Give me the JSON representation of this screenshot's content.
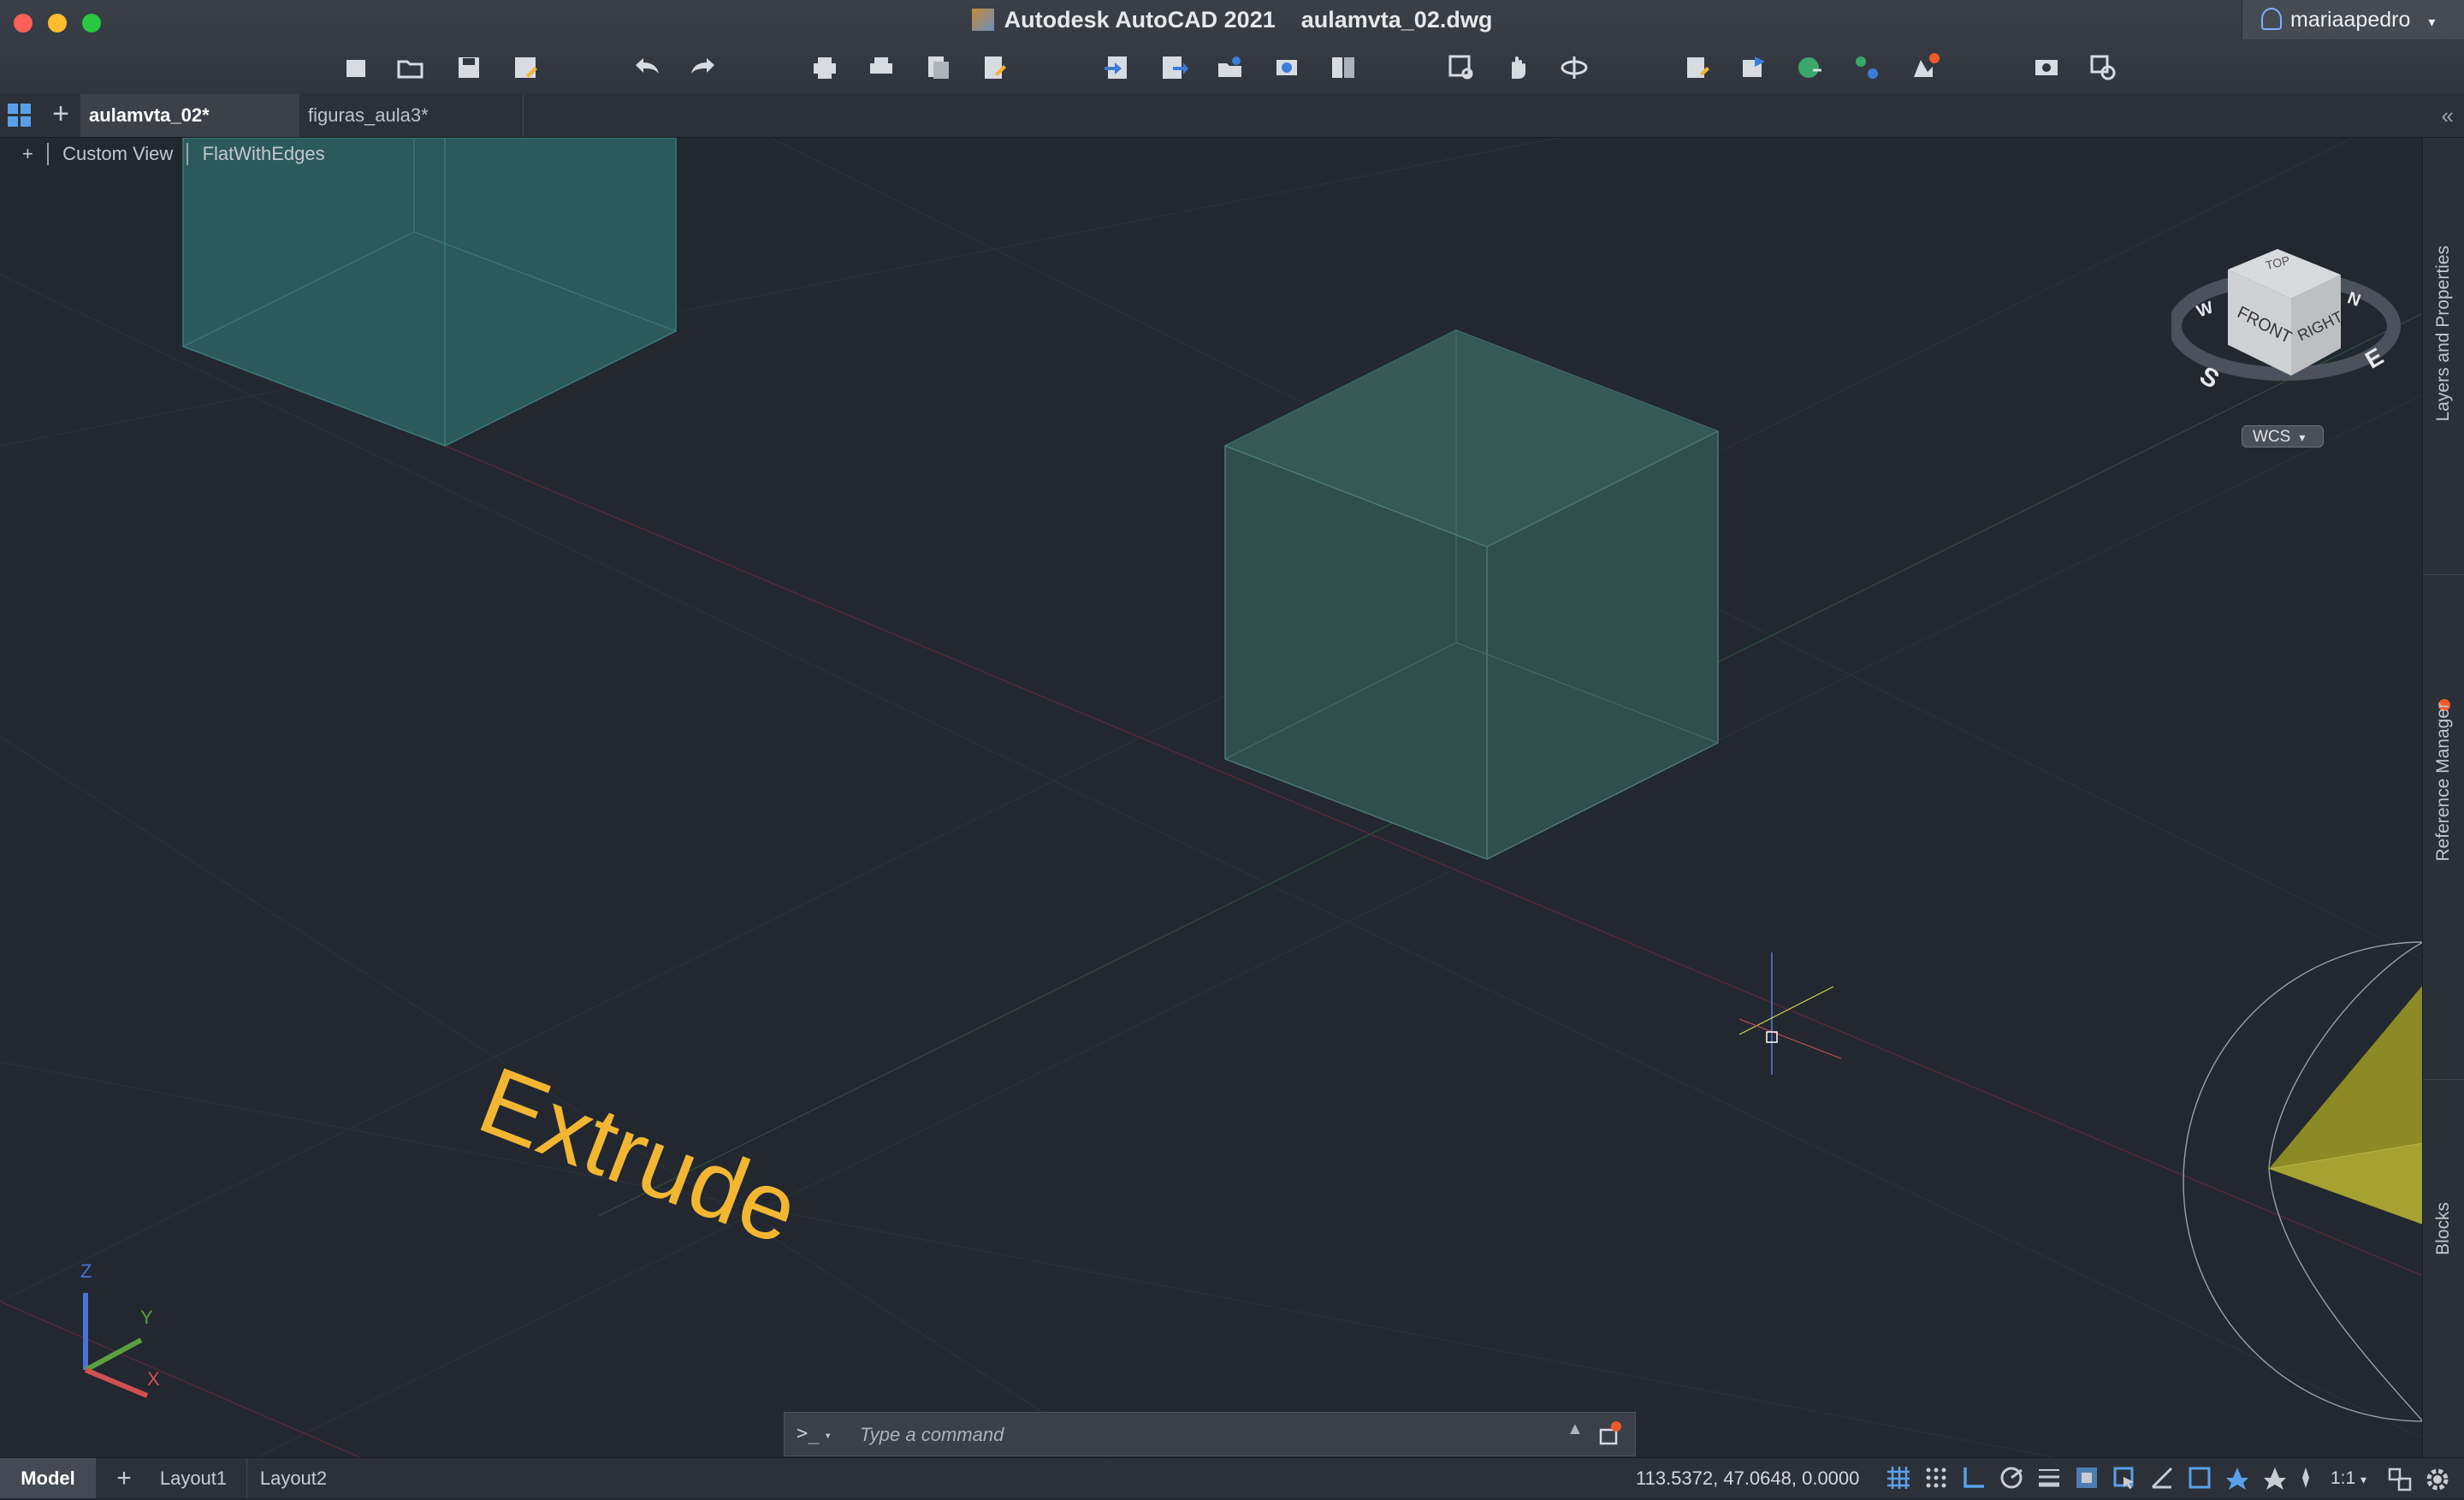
{
  "window": {
    "app_title": "Autodesk AutoCAD 2021",
    "file_title": "aulamvta_02.dwg",
    "user": "mariaapedro"
  },
  "toolbar_icons": [
    "new-icon",
    "open-icon",
    "save-icon",
    "save-as-icon",
    "undo-icon",
    "redo-icon",
    "plot-icon",
    "batch-plot-icon",
    "publish-icon",
    "page-setup-icon",
    "import-icon",
    "export-icon",
    "attach-icon",
    "share-icon",
    "compare-icon",
    "zoom-window-icon",
    "pan-icon",
    "orbit-icon",
    "properties-icon",
    "layer-icon",
    "xref-icon",
    "block-icon",
    "render-icon",
    "capture-icon",
    "find-icon"
  ],
  "tabs": [
    {
      "label": "aulamvta_02*",
      "active": true
    },
    {
      "label": "figuras_aula3*",
      "active": false
    }
  ],
  "viewport": {
    "control_plus": "+",
    "view_name": "Custom View",
    "visual_style": "FlatWithEdges",
    "text_object": "Extrude",
    "viewcube": {
      "top": "TOP",
      "front": "FRONT",
      "right": "RIGHT",
      "compass_s": "S",
      "compass_e": "E",
      "compass_w": "W",
      "compass_n": "N"
    },
    "ucs_button": "WCS",
    "ucs_axes": {
      "x": "X",
      "y": "Y",
      "z": "Z"
    },
    "colors": {
      "background": "#222730",
      "solid_face": "#2d5a5c",
      "text": "#f2b632",
      "cone": "#8c8a25"
    }
  },
  "right_panel": {
    "layers": "Layers and Properties",
    "reference": "Reference Manager",
    "blocks": "Blocks"
  },
  "command": {
    "prompt": ">_",
    "placeholder": "Type a command"
  },
  "status": {
    "model_tab": "Model",
    "layouts": [
      "Layout1",
      "Layout2"
    ],
    "coordinates": "113.5372, 47.0648, 0.0000",
    "scale": "1:1"
  }
}
